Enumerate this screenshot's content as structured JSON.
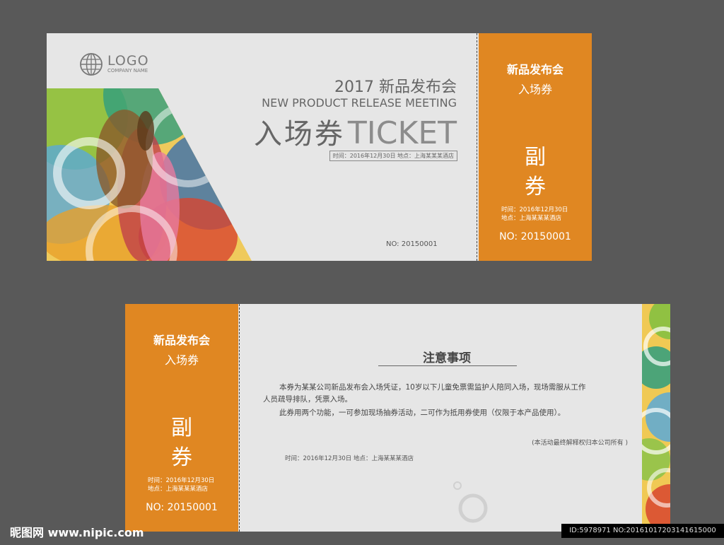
{
  "front": {
    "logo": {
      "main": "LOGO",
      "sub": "COMPANY NAME"
    },
    "year_title": "2017 新品发布会",
    "english_title": "NEW PRODUCT RELEASE MEETING",
    "big_cn": "入场券",
    "big_en": "TICKET",
    "info_line": "时间：2016年12月30日    地点：上海某某某酒店",
    "number": "NO: 20150001",
    "stub": {
      "title": "新品发布会",
      "subtitle": "入场券",
      "fu": "副",
      "quan": "券",
      "time": "时间：2016年12月30日",
      "place": "地点：上海某某某酒店",
      "number": "NO: 20150001"
    }
  },
  "back": {
    "stub": {
      "title": "新品发布会",
      "subtitle": "入场券",
      "fu": "副",
      "quan": "券",
      "time": "时间：2016年12月30日",
      "place": "地点：上海某某某酒店",
      "number": "NO: 20150001"
    },
    "notice_title": "注意事项",
    "paragraph1_line1": "本券为某某公司新品发布会入场凭证，10岁以下儿童免票需监护人陪同入场，现场需服从工作",
    "paragraph1_line2": "人员疏导排队，凭票入场。",
    "paragraph2": "此券用两个功能，一可参加现场抽券活动，二可作为抵用券使用（仅限于本产品使用）。",
    "rights": "(本活动最终解释权归本公司所有 )",
    "info_line": "时间：2016年12月30日    地点：上海某某某酒店"
  },
  "watermark": {
    "left": "昵图网 www.nipic.com",
    "right": "ID:5978971 NO:20161017203141615000"
  },
  "colors": {
    "orange": "#e08722",
    "ticket_bg": "#e6e6e6",
    "page_bg": "#595959"
  }
}
